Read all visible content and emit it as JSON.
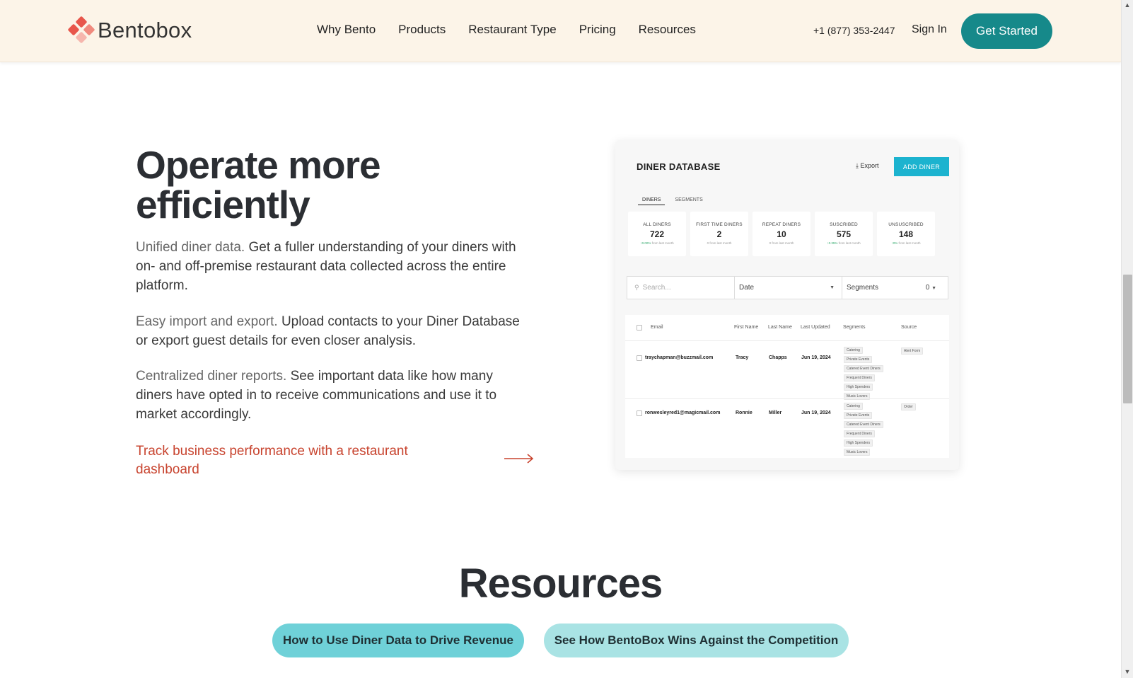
{
  "header": {
    "brand": "Bentobox",
    "nav": [
      "Why Bento",
      "Products",
      "Restaurant Type",
      "Pricing",
      "Resources"
    ],
    "phone": "+1 (877) 353-2447",
    "signin": "Sign In",
    "cta": "Get Started"
  },
  "hero": {
    "title": "Operate more efficiently",
    "p1_lead": "Unified diner data.",
    "p1_rest": "Get a fuller understanding of your diners with on- and off-premise restaurant data collected across the entire platform.",
    "p2_lead": "Easy import and export.",
    "p2_rest": "Upload contacts to your Diner Database or export guest details for even closer analysis.",
    "p3_lead": "Centralized diner reports.",
    "p3_rest": "See important data like how many diners have opted in to receive communications and use it to market accordingly.",
    "link": "Track business performance with a restaurant dashboard"
  },
  "dashboard": {
    "title": "DINER DATABASE",
    "export": "Export",
    "add": "ADD DINER",
    "tabs": [
      "DINERS",
      "SEGMENTS"
    ],
    "stats": [
      {
        "label": "ALL DINERS",
        "value": "722",
        "up": "↑0.00%",
        "sub": "from last month"
      },
      {
        "label": "FIRST TIME DINERS",
        "value": "2",
        "up": "",
        "sub": "0 from last month"
      },
      {
        "label": "REPEAT DINERS",
        "value": "10",
        "up": "",
        "sub": "0 from last month"
      },
      {
        "label": "SUSCRIBED",
        "value": "575",
        "up": "↑0.35%",
        "sub": "from last month"
      },
      {
        "label": "UNSUSCRIBED",
        "value": "148",
        "up": "↑0%",
        "sub": "from last month"
      }
    ],
    "search_placeholder": "Search...",
    "date_filter": "Date",
    "segments_filter": "Segments",
    "segments_count": "0",
    "columns": [
      "Email",
      "First Name",
      "Last Name",
      "Last Updated",
      "Segments",
      "Source"
    ],
    "rows": [
      {
        "email": "traychapman@buzzmail.com",
        "first": "Tracy",
        "last": "Chapps",
        "updated": "Jun 19, 2024",
        "segments": [
          "Catering",
          "Private Events",
          "Catered Event Diners",
          "Frequent Diners",
          "High Spenders",
          "Music Lovers"
        ],
        "source": "Alert Form"
      },
      {
        "email": "ronwesleyred1@magicmail.com",
        "first": "Ronnie",
        "last": "Miller",
        "updated": "Jun 19, 2024",
        "segments": [
          "Catering",
          "Private Events",
          "Catered Event Diners",
          "Frequent Diners",
          "High Spenders",
          "Music Lovers"
        ],
        "source": "Order"
      }
    ]
  },
  "resources": {
    "title": "Resources",
    "pills": [
      "How to Use Diner Data to Drive Revenue",
      "See How BentoBox Wins Against the Competition"
    ]
  },
  "colors": {
    "header_bg": "#fcf4e8",
    "cta": "#16898a",
    "link": "#c8442f",
    "add_diner": "#1cb3cf",
    "pill1": "#6fd1d8",
    "pill2": "#a9e3e4"
  }
}
